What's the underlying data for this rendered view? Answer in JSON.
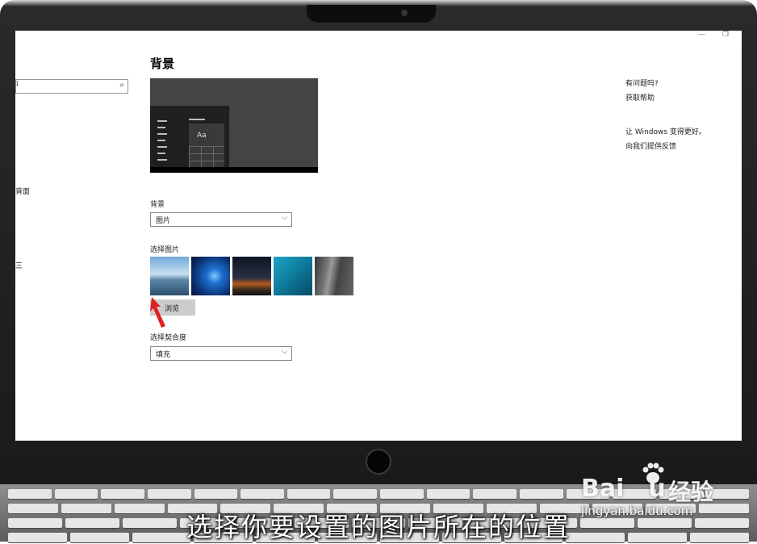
{
  "window": {
    "minimize_glyph": "—",
    "maximize_glyph": "❐"
  },
  "nav": {
    "search_text": "ī",
    "search_icon": "⌕",
    "frag_1": "背面",
    "frag_2": "三"
  },
  "main": {
    "page_title": "背景",
    "preview_sample_text": "Aa",
    "background_label": "背景",
    "background_value": "图片",
    "choose_picture_label": "选择图片",
    "browse_label": "浏览",
    "fit_label": "选择契合度",
    "fit_value": "填充",
    "chevron": "⌵"
  },
  "help": {
    "question": "有问题吗?",
    "get_help": "获取帮助",
    "improve": "让 Windows 变得更好。",
    "feedback": "向我们提供反馈"
  },
  "overlay": {
    "subtitle": "选择你要设置的图片所在的位置",
    "watermark_brand": "Bai",
    "watermark_brand2": "u",
    "watermark_cn": "经验",
    "watermark_url": "jingyan.baidu.com"
  },
  "colors": {
    "accent_arrow": "#e02020",
    "browse_button_bg": "#cccccc",
    "preview_bg": "#444444"
  },
  "icons": [
    "search-icon",
    "chevron-down-icon",
    "red-arrow-icon",
    "baidu-paw-icon"
  ]
}
